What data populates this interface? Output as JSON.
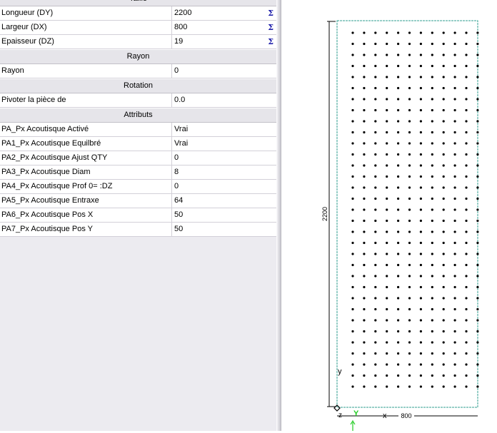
{
  "properties": {
    "sections": {
      "size": "Taille",
      "radius": "Rayon",
      "rotation": "Rotation",
      "attributes": "Attributs"
    },
    "dimensions": [
      {
        "label": "Longueur (DY)",
        "value": "2200",
        "icon": "sigma-icon",
        "icon_glyph": "Σ"
      },
      {
        "label": "Largeur (DX)",
        "value": "800",
        "icon": "sigma-icon",
        "icon_glyph": "Σ"
      },
      {
        "label": "Epaisseur (DZ)",
        "value": "19",
        "icon": "sigma-icon",
        "icon_glyph": "Σ"
      }
    ],
    "radius_row": {
      "label": "Rayon",
      "value": "0"
    },
    "rotation_row": {
      "label": "Pivoter la pièce de",
      "value": "0.0"
    },
    "attributes": [
      {
        "label": "PA_Px Acoutisque Activé",
        "value": "Vrai"
      },
      {
        "label": "PA1_Px Acoutisque Equilbré",
        "value": "Vrai"
      },
      {
        "label": "PA2_Px Acoutisque Ajust QTY",
        "value": "0"
      },
      {
        "label": "PA3_Px Acoutisque Diam",
        "value": "8"
      },
      {
        "label": "PA4_Px Acoutisque Prof 0= :DZ",
        "value": "0"
      },
      {
        "label": "PA5_Px Acoutisque Entraxe",
        "value": "64"
      },
      {
        "label": "PA6_Px Acoutisque Pos X",
        "value": "50"
      },
      {
        "label": "PA7_Px Acoutisque Pos Y",
        "value": "50"
      }
    ]
  },
  "drawing": {
    "dim_height_label": "2200",
    "dim_width_label": "800",
    "axis_y_label": "y",
    "axis_Y_label": "Y",
    "axis_x_label": "x",
    "axis_z_label": "z",
    "hole_columns": 12,
    "hole_rows": 33,
    "colors": {
      "border": "#2f9e8f",
      "dim_line": "#000000",
      "hole": "#000000",
      "axis_green": "#22cc22"
    }
  }
}
